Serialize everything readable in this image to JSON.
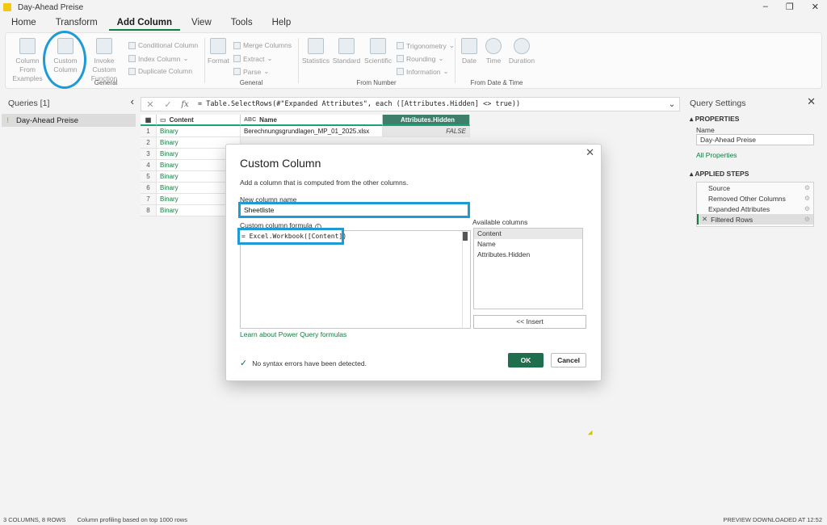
{
  "window": {
    "title": "Day-Ahead Preise"
  },
  "menu": {
    "tabs": [
      "Home",
      "Transform",
      "Add Column",
      "View",
      "Tools",
      "Help"
    ]
  },
  "ribbon": {
    "general": {
      "label": "General",
      "column_from_examples": "Column From Examples",
      "custom_column": "Custom Column",
      "invoke_custom_function": "Invoke Custom Function",
      "conditional_column": "Conditional Column",
      "index_column": "Index Column",
      "duplicate_column": "Duplicate Column"
    },
    "from_text": {
      "label": "General",
      "format": "Format",
      "merge_columns": "Merge Columns",
      "extract": "Extract",
      "parse": "Parse"
    },
    "from_number": {
      "label": "From Number",
      "statistics": "Statistics",
      "standard": "Standard",
      "scientific": "Scientific",
      "trigonometry": "Trigonometry",
      "rounding": "Rounding",
      "information": "Information"
    },
    "from_date_time": {
      "label": "From Date & Time",
      "date": "Date",
      "time": "Time",
      "duration": "Duration"
    }
  },
  "queries": {
    "header": "Queries [1]",
    "items": [
      {
        "name": "Day-Ahead Preise"
      }
    ]
  },
  "formula_bar": {
    "text": "= Table.SelectRows(#\"Expanded Attributes\", each ([Attributes.Hidden] <> true))"
  },
  "grid": {
    "columns": [
      "Content",
      "Name",
      "Attributes.Hidden"
    ],
    "rows": [
      {
        "n": "1",
        "content": "Binary",
        "name": "Berechnungsgrundlagen_MP_01_2025.xlsx",
        "hidden": "FALSE"
      },
      {
        "n": "2",
        "content": "Binary"
      },
      {
        "n": "3",
        "content": "Binary"
      },
      {
        "n": "4",
        "content": "Binary"
      },
      {
        "n": "5",
        "content": "Binary"
      },
      {
        "n": "6",
        "content": "Binary"
      },
      {
        "n": "7",
        "content": "Binary"
      },
      {
        "n": "8",
        "content": "Binary"
      }
    ]
  },
  "settings": {
    "title": "Query Settings",
    "properties": "PROPERTIES",
    "name_label": "Name",
    "name_value": "Day-Ahead Preise",
    "all_properties": "All Properties",
    "applied_steps": "APPLIED STEPS",
    "steps": [
      "Source",
      "Removed Other Columns",
      "Expanded Attributes",
      "Filtered Rows"
    ]
  },
  "dialog": {
    "title": "Custom Column",
    "description": "Add a column that is computed from the other columns.",
    "new_column_label": "New column name",
    "new_column_value": "Sheetliste",
    "formula_label": "Custom column formula",
    "formula_value": "= Excel.Workbook([Content])",
    "available_label": "Available columns",
    "available": [
      "Content",
      "Name",
      "Attributes.Hidden"
    ],
    "insert": "<< Insert",
    "learn_link": "Learn about Power Query formulas",
    "syntax": "No syntax errors have been detected.",
    "ok": "OK",
    "cancel": "Cancel"
  },
  "status": {
    "counts": "3 COLUMNS, 8 ROWS",
    "profiling": "Column profiling based on top 1000 rows",
    "preview": "PREVIEW DOWNLOADED AT 12:52"
  },
  "colors": {
    "accent": "#107c41",
    "highlight": "#1e9ad6",
    "ok_button": "#1f6e4e"
  }
}
